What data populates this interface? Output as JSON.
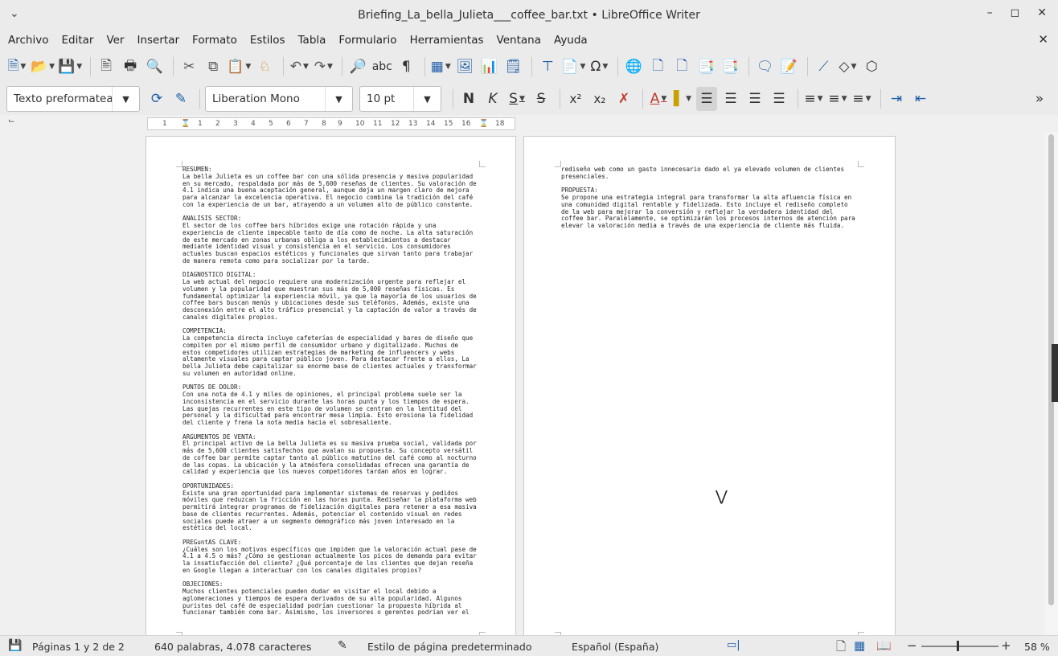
{
  "window": {
    "title": "Briefing_La_bella_Julieta___coffee_bar.txt • LibreOffice Writer",
    "menu_icon": "chevron-down-icon"
  },
  "menu": [
    "Archivo",
    "Editar",
    "Ver",
    "Insertar",
    "Formato",
    "Estilos",
    "Tabla",
    "Formulario",
    "Herramientas",
    "Ventana",
    "Ayuda"
  ],
  "format_bar": {
    "paragraph_style": "Texto preformatea",
    "font_name": "Liberation Mono",
    "font_size": "10 pt"
  },
  "ruler": {
    "ticks": [
      "1",
      "1",
      "2",
      "3",
      "4",
      "5",
      "6",
      "7",
      "8",
      "9",
      "10",
      "11",
      "12",
      "13",
      "14",
      "15",
      "16",
      "17",
      "18"
    ]
  },
  "document": {
    "page1": "RESUMEN:\nLa bella Julieta es un coffee bar con una sólida presencia y masiva popularidad\nen su mercado, respaldada por más de 5,600 reseñas de clientes. Su valoración de\n4.1 indica una buena aceptación general, aunque deja un margen claro de mejora\npara alcanzar la excelencia operativa. El negocio combina la tradición del café\ncon la experiencia de un bar, atrayendo a un volumen alto de público constante.\n\nANALISIS SECTOR:\nEl sector de los coffee bars híbridos exige una rotación rápida y una\nexperiencia de cliente impecable tanto de día como de noche. La alta saturación\nde este mercado en zonas urbanas obliga a los establecimientos a destacar\nmediante identidad visual y consistencia en el servicio. Los consumidores\nactuales buscan espacios estéticos y funcionales que sirvan tanto para trabajar\nde manera remota como para socializar por la tarde.\n\nDIAGNOSTICO DIGITAL:\nLa web actual del negocio requiere una modernización urgente para reflejar el\nvolumen y la popularidad que muestran sus más de 5,000 reseñas físicas. Es\nfundamental optimizar la experiencia móvil, ya que la mayoría de los usuarios de\ncoffee bars buscan menús y ubicaciones desde sus teléfonos. Además, existe una\ndesconexión entre el alto tráfico presencial y la captación de valor a través de\ncanales digitales propios.\n\nCOMPETENCIA:\nLa competencia directa incluye cafeterías de especialidad y bares de diseño que\ncompiten por el mismo perfil de consumidor urbano y digitalizado. Muchos de\nestos competidores utilizan estrategias de marketing de influencers y webs\naltamente visuales para captar público joven. Para destacar frente a ellos, La\nbella Julieta debe capitalizar su enorme base de clientes actuales y transformar\nsu volumen en autoridad online.\n\nPUNTOS DE DOLOR:\nCon una nota de 4.1 y miles de opiniones, el principal problema suele ser la\ninconsistencia en el servicio durante las horas punta y los tiempos de espera.\nLas quejas recurrentes en este tipo de volumen se centran en la lentitud del\npersonal y la dificultad para encontrar mesa limpia. Esto erosiona la fidelidad\ndel cliente y frena la nota media hacia el sobresaliente.\n\nARGUMENTOS DE VENTA:\nEl principal activo de La bella Julieta es su masiva prueba social, validada por\nmás de 5,600 clientes satisfechos que avalan su propuesta. Su concepto versátil\nde coffee bar permite captar tanto al público matutino del café como al nocturno\nde las copas. La ubicación y la atmósfera consolidadas ofrecen una garantía de\ncalidad y experiencia que los nuevos competidores tardan años en lograr.\n\nOPORTUNIDADES:\nExiste una gran oportunidad para implementar sistemas de reservas y pedidos\nmóviles que reduzcan la fricción en las horas punta. Rediseñar la plataforma web\npermitirá integrar programas de fidelización digitales para retener a esa masiva\nbase de clientes recurrentes. Además, potenciar el contenido visual en redes\nsociales puede atraer a un segmento demográfico más joven interesado en la\nestética del local.\n\nPREGuntAS CLAVE:\n¿Cuáles son los motivos específicos que impiden que la valoración actual pase de\n4.1 a 4.5 o más? ¿Cómo se gestionan actualmente los picos de demanda para evitar\nla insatisfacción del cliente? ¿Qué porcentaje de los clientes que dejan reseña\nen Google llegan a interactuar con los canales digitales propios?\n\nOBJECIONES:\nMuchos clientes potenciales pueden dudar en visitar el local debido a\naglomeraciones y tiempos de espera derivados de su alta popularidad. Algunos\npuristas del café de especialidad podrían cuestionar la propuesta híbrida al\nfuncionar también como bar. Asimismo, los inversores o gerentes podrían ver el",
    "page2": "rediseño web como un gasto innecesario dado el ya elevado volumen de clientes\npresenciales.\n\nPROPUESTA:\nSe propone una estrategia integral para transformar la alta afluencia física en\nuna comunidad digital rentable y fidelizada. Esto incluye el rediseño completo\nde la web para mejorar la conversión y reflejar la verdadera identidad del\ncoffee bar. Paralelamente, se optimizarán los procesos internos de atención para\nelevar la valoración media a través de una experiencia de cliente más fluida."
  },
  "status": {
    "pages": "Páginas 1 y 2 de 2",
    "words": "640 palabras, 4.078 caracteres",
    "page_style": "Estilo de página predeterminado",
    "language": "Español (España)",
    "zoom": "58 %"
  }
}
